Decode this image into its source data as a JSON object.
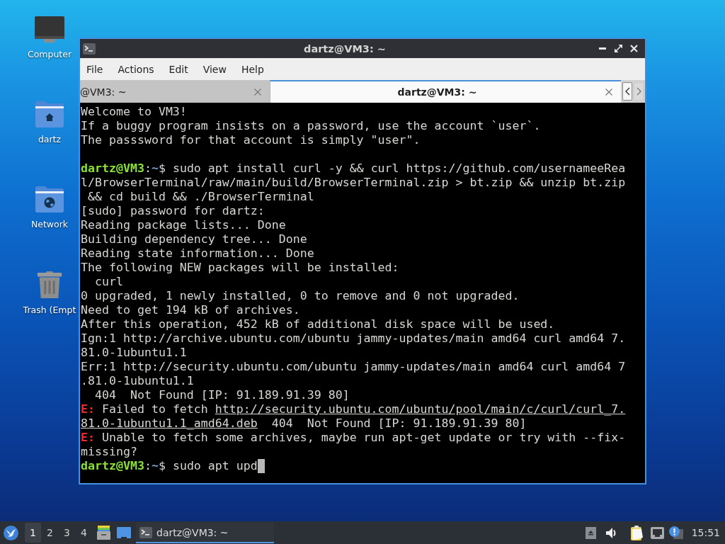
{
  "desktop_icons": [
    {
      "label": "Computer",
      "kind": "computer"
    },
    {
      "label": "dartz",
      "kind": "home"
    },
    {
      "label": "Network",
      "kind": "network"
    },
    {
      "label": "Trash (Empt",
      "kind": "trash"
    }
  ],
  "window": {
    "title": "dartz@VM3: ~",
    "menu": [
      "File",
      "Actions",
      "Edit",
      "View",
      "Help"
    ],
    "tabs": [
      {
        "label": "@VM3: ~",
        "selected": false
      },
      {
        "label": "dartz@VM3: ~",
        "selected": true
      }
    ],
    "scroll_buttons": [
      {
        "kind": "left",
        "disabled": false
      },
      {
        "kind": "right",
        "disabled": true
      }
    ]
  },
  "terminal": {
    "lines": [
      {
        "kind": "text",
        "segments": [
          {
            "kind": "plain",
            "text": "Welcome to VM3!"
          }
        ]
      },
      {
        "kind": "text",
        "segments": [
          {
            "kind": "plain",
            "text": "If a buggy program insists on a password, use the account `user`."
          }
        ]
      },
      {
        "kind": "text",
        "segments": [
          {
            "kind": "plain",
            "text": "The passsword for that account is simply \"user\"."
          }
        ]
      },
      {
        "kind": "blank"
      },
      {
        "kind": "text",
        "segments": [
          {
            "kind": "user",
            "text": "dartz@VM3"
          },
          {
            "kind": "plain",
            "text": ":"
          },
          {
            "kind": "path",
            "text": "~"
          },
          {
            "kind": "plain",
            "text": "$ sudo apt install curl -y && curl https://github.com/usernameeRea"
          }
        ]
      },
      {
        "kind": "text",
        "segments": [
          {
            "kind": "plain",
            "text": "l/BrowserTerminal/raw/main/build/BrowserTerminal.zip > bt.zip && unzip bt.zip"
          }
        ]
      },
      {
        "kind": "text",
        "segments": [
          {
            "kind": "plain",
            "text": " && cd build && ./BrowserTerminal"
          }
        ]
      },
      {
        "kind": "text",
        "segments": [
          {
            "kind": "plain",
            "text": "[sudo] password for dartz:"
          }
        ]
      },
      {
        "kind": "text",
        "segments": [
          {
            "kind": "plain",
            "text": "Reading package lists... Done"
          }
        ]
      },
      {
        "kind": "text",
        "segments": [
          {
            "kind": "plain",
            "text": "Building dependency tree... Done"
          }
        ]
      },
      {
        "kind": "text",
        "segments": [
          {
            "kind": "plain",
            "text": "Reading state information... Done"
          }
        ]
      },
      {
        "kind": "text",
        "segments": [
          {
            "kind": "plain",
            "text": "The following NEW packages will be installed:"
          }
        ]
      },
      {
        "kind": "text",
        "segments": [
          {
            "kind": "plain",
            "text": "  curl"
          }
        ]
      },
      {
        "kind": "text",
        "segments": [
          {
            "kind": "plain",
            "text": "0 upgraded, 1 newly installed, 0 to remove and 0 not upgraded."
          }
        ]
      },
      {
        "kind": "text",
        "segments": [
          {
            "kind": "plain",
            "text": "Need to get 194 kB of archives."
          }
        ]
      },
      {
        "kind": "text",
        "segments": [
          {
            "kind": "plain",
            "text": "After this operation, 452 kB of additional disk space will be used."
          }
        ]
      },
      {
        "kind": "text",
        "segments": [
          {
            "kind": "plain",
            "text": "Ign:1 http://archive.ubuntu.com/ubuntu jammy-updates/main amd64 curl amd64 7."
          }
        ]
      },
      {
        "kind": "text",
        "segments": [
          {
            "kind": "plain",
            "text": "81.0-1ubuntu1.1"
          }
        ]
      },
      {
        "kind": "text",
        "segments": [
          {
            "kind": "plain",
            "text": "Err:1 http://security.ubuntu.com/ubuntu jammy-updates/main amd64 curl amd64 7"
          }
        ]
      },
      {
        "kind": "text",
        "segments": [
          {
            "kind": "plain",
            "text": ".81.0-1ubuntu1.1"
          }
        ]
      },
      {
        "kind": "text",
        "segments": [
          {
            "kind": "plain",
            "text": "  404  Not Found [IP: 91.189.91.39 80]"
          }
        ]
      },
      {
        "kind": "text",
        "segments": [
          {
            "kind": "error",
            "text": "E:"
          },
          {
            "kind": "plain",
            "text": " Failed to fetch "
          },
          {
            "kind": "link",
            "text": "http://security.ubuntu.com/ubuntu/pool/main/c/curl/curl_7."
          }
        ]
      },
      {
        "kind": "text",
        "segments": [
          {
            "kind": "link",
            "text": "81.0-1ubuntu1.1_amd64.deb"
          },
          {
            "kind": "plain",
            "text": "  404  Not Found [IP: 91.189.91.39 80]"
          }
        ]
      },
      {
        "kind": "text",
        "segments": [
          {
            "kind": "error",
            "text": "E:"
          },
          {
            "kind": "plain",
            "text": " Unable to fetch some archives, maybe run apt-get update or try with --fix-"
          }
        ]
      },
      {
        "kind": "text",
        "segments": [
          {
            "kind": "plain",
            "text": "missing?"
          }
        ]
      },
      {
        "kind": "text",
        "segments": [
          {
            "kind": "user",
            "text": "dartz@VM3"
          },
          {
            "kind": "plain",
            "text": ":"
          },
          {
            "kind": "path",
            "text": "~"
          },
          {
            "kind": "plain",
            "text": "$ sudo apt upd"
          },
          {
            "kind": "cursor"
          }
        ]
      }
    ]
  },
  "taskbar": {
    "workspaces": [
      {
        "label": "1",
        "selected": true
      },
      {
        "label": "2",
        "selected": false
      },
      {
        "label": "3",
        "selected": false
      },
      {
        "label": "4",
        "selected": false
      }
    ],
    "tasks": [
      {
        "label": "dartz@VM3: ~",
        "selected": true
      }
    ],
    "clock": "15:51"
  }
}
